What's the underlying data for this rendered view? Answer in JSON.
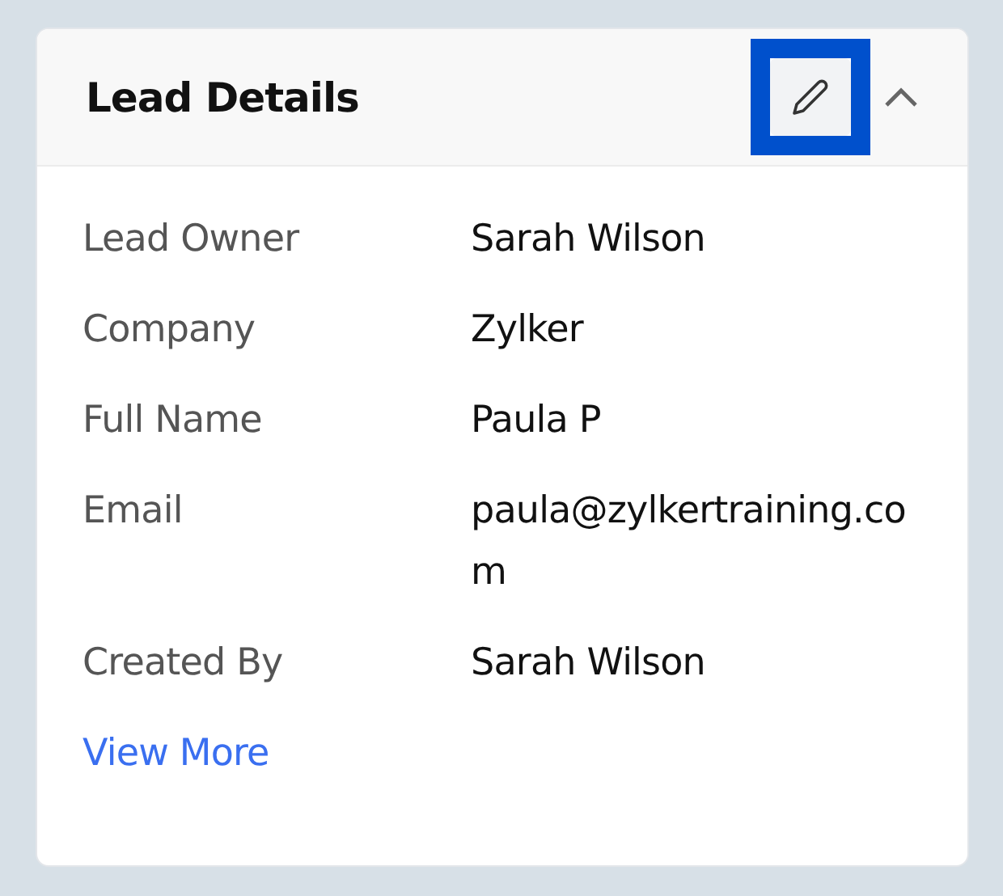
{
  "card": {
    "title": "Lead Details",
    "edit_highlighted": true,
    "expanded": true,
    "fields": [
      {
        "label": "Lead Owner",
        "value": "Sarah Wilson"
      },
      {
        "label": "Company",
        "value": "Zylker"
      },
      {
        "label": "Full Name",
        "value": "Paula P"
      },
      {
        "label": "Email",
        "value": "paula@zylkertraining.com"
      },
      {
        "label": "Created By",
        "value": "Sarah Wilson"
      }
    ],
    "link": "View More"
  }
}
